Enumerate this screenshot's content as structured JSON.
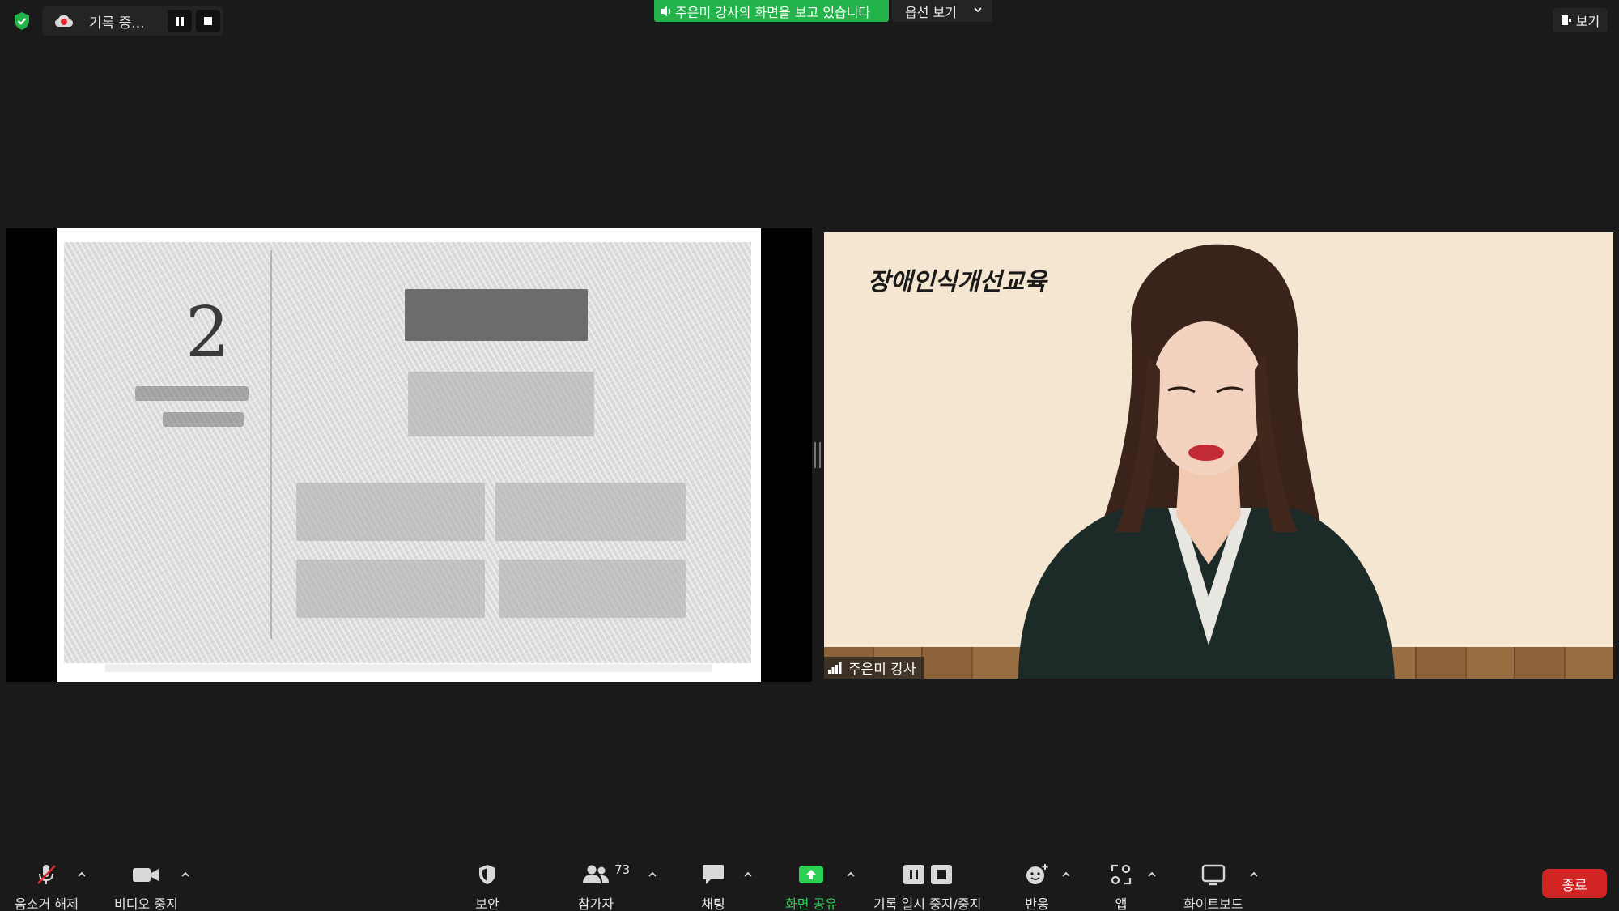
{
  "top_bar": {
    "recording_label": "기록 중...",
    "share_banner": "주은미 강사의 화면을 보고 있습니다",
    "view_options": "옵션 보기",
    "view_button": "보기"
  },
  "shared_screen": {
    "slide_number": "2"
  },
  "speaker_video": {
    "title": "장애인식개선교육",
    "name": "주은미 강사"
  },
  "toolbar": {
    "mute_label": "음소거 해제",
    "video_label": "비디오 중지",
    "security_label": "보안",
    "participants_label": "참가자",
    "participants_count": "73",
    "chat_label": "채팅",
    "share_label": "화면 공유",
    "record_label": "기록 일시 중지/중지",
    "reactions_label": "반응",
    "apps_label": "앱",
    "whiteboard_label": "화이트보드",
    "end_label": "종료"
  },
  "colors": {
    "background": "#1a1a1a",
    "share_green": "#22b34a",
    "end_red": "#d32424",
    "video_bg": "#f4e6d1"
  }
}
